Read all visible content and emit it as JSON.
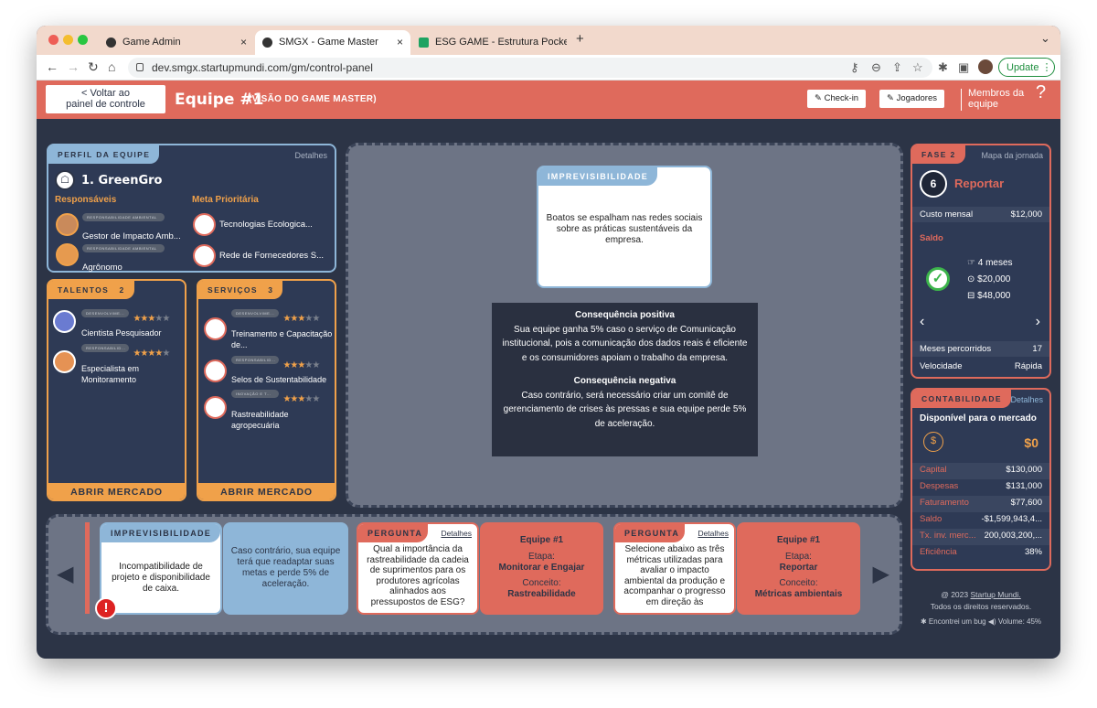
{
  "browser": {
    "tabs": [
      {
        "label": "Game Admin"
      },
      {
        "label": "SMGX - Game Master"
      },
      {
        "label": "ESG GAME - Estrutura Pocket"
      }
    ],
    "new_tab": "+",
    "tab_close": "×",
    "chevron": "⌄",
    "url": "dev.smgx.startupmundi.com/gm/control-panel",
    "update": "Update"
  },
  "header": {
    "back": "< Voltar ao",
    "back2": "painel de controle",
    "team": "Equipe #1",
    "gm_view": "(VISÃO DO GAME MASTER)",
    "checkin": "Check-in",
    "players": "Jogadores",
    "members": "Membros da",
    "members2": "equipe",
    "help": "?"
  },
  "profile": {
    "tag": "PERFIL DA EQUIPE",
    "details": "Detalhes",
    "team_name": "1. GreenGro",
    "responsibles": "Responsáveis",
    "meta": "Meta Prioritária",
    "people": [
      {
        "pill": "RESPONSABILIDADE AMBIENTAL",
        "name": "Gestor de Impacto Amb..."
      },
      {
        "pill": "RESPONSABILIDADE AMBIENTAL",
        "name": "Agrônomo"
      }
    ],
    "goals": [
      {
        "name": "Tecnologias Ecologica..."
      },
      {
        "name": "Rede de Fornecedores S..."
      }
    ]
  },
  "talents": {
    "tag": "TALENTOS",
    "count": "2",
    "items": [
      {
        "pill": "DESENVOLVIME...",
        "name": "Cientista Pesquisador",
        "stars": 3
      },
      {
        "pill": "RESPONSABILID...",
        "name": "Especialista em Monitoramento",
        "stars": 4
      }
    ],
    "button": "ABRIR MERCADO"
  },
  "services": {
    "tag": "SERVIÇOS",
    "count": "3",
    "items": [
      {
        "pill": "DESENVOLVIME...",
        "name": "Treinamento e Capacitação de...",
        "stars": 3
      },
      {
        "pill": "RESPONSABILID...",
        "name": "Selos de Sustentabilidade",
        "stars": 3
      },
      {
        "pill": "INOVAÇÃO E T...",
        "name": "Rastreabilidade agropecuária",
        "stars": 3
      }
    ],
    "button": "ABRIR MERCADO"
  },
  "center": {
    "card_title": "IMPREVISIBILIDADE",
    "card_text": "Boatos se espalham nas redes sociais sobre as práticas sustentáveis da empresa.",
    "pos_title": "Consequência positiva",
    "pos_text": "Sua equipe ganha 5% caso o serviço de Comunicação institucional, pois a comunicação dos dados reais é eficiente e os consumidores apoiam o trabalho da empresa.",
    "neg_title": "Consequência negativa",
    "neg_text": "Caso contrário, será necessário criar um comitê de gerenciamento de crises às pressas e sua equipe perde 5% de aceleração."
  },
  "phase": {
    "tag": "FASE 2",
    "map": "Mapa da jornada",
    "num": "6",
    "title": "Reportar",
    "monthly_label": "Custo mensal",
    "monthly": "$12,000",
    "saldo": "Saldo",
    "months": "4 meses",
    "v1": "$20,000",
    "v2": "$48,000",
    "months_done_label": "Meses percorridos",
    "months_done": "17",
    "speed_label": "Velocidade",
    "speed": "Rápida"
  },
  "accounting": {
    "tag": "CONTABILIDADE",
    "details": "Detalhes",
    "available": "Disponível para o mercado",
    "amount": "$0",
    "rows": [
      {
        "label": "Capital",
        "value": "$130,000"
      },
      {
        "label": "Despesas",
        "value": "$131,000"
      },
      {
        "label": "Faturamento",
        "value": "$77,600"
      },
      {
        "label": "Saldo",
        "value": "-$1,599,943,4..."
      },
      {
        "label": "Tx. inv. merc...",
        "value": "200,003,200,..."
      },
      {
        "label": "Eficiência",
        "value": "38%"
      }
    ]
  },
  "footer": {
    "copy": "@ 2023",
    "brand": "Startup Mundi.",
    "rights": "Todos os direitos reservados.",
    "bug": "Encontrei um bug",
    "volume": "Volume: 45%"
  },
  "bottom": {
    "c1_title": "IMPREVISIBILIDADE",
    "c1_text": "Incompatibilidade de projeto e disponibilidade de caixa.",
    "c2_text": "Caso contrário, sua equipe terá que readaptar suas metas e perde 5% de aceleração.",
    "q1_title": "PERGUNTA",
    "q1_details": "Detalhes",
    "q1_text": "Qual a importância da rastreabilidade da cadeia de suprimentos para os produtores agrícolas alinhados aos pressupostos de ESG?",
    "t1_team": "Equipe #1",
    "t1_stage_label": "Etapa:",
    "t1_stage": "Monitorar e Engajar",
    "t1_concept_label": "Conceito:",
    "t1_concept": "Rastreabilidade",
    "q2_title": "PERGUNTA",
    "q2_details": "Detalhes",
    "q2_text": "Selecione abaixo as três métricas utilizadas para avaliar o impacto ambiental da produção e acompanhar o progresso em direção às",
    "t2_team": "Equipe #1",
    "t2_stage_label": "Etapa:",
    "t2_stage": "Reportar",
    "t2_concept_label": "Conceito:",
    "t2_concept": "Métricas ambientais",
    "alert": "!"
  },
  "colors": {
    "coral": "#df6a5c",
    "navy": "#2c3446",
    "orange": "#f0a14a",
    "blue": "#8eb6d8"
  }
}
